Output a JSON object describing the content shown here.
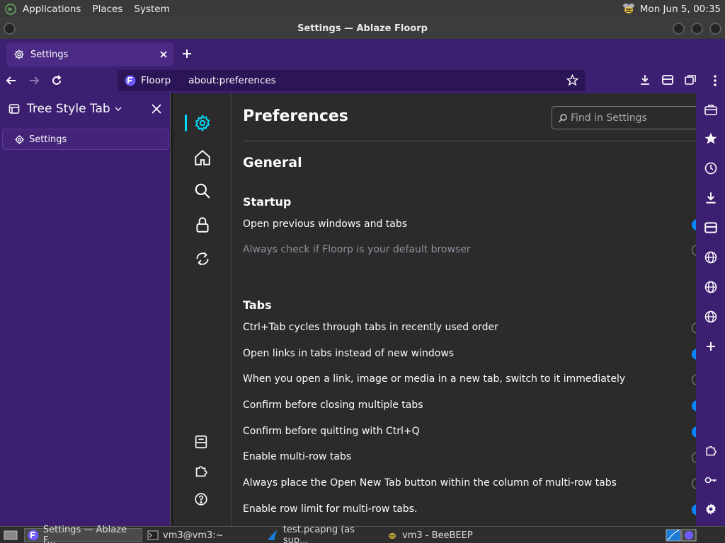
{
  "top_panel": {
    "menus": [
      "Applications",
      "Places",
      "System"
    ],
    "clock": "Mon Jun  5, 00:35"
  },
  "window": {
    "title": "Settings — Ablaze Floorp"
  },
  "tabs": {
    "active_tab_label": "Settings"
  },
  "urlbar": {
    "identity_label": "Floorp",
    "url": "about:preferences"
  },
  "sidebar": {
    "title": "Tree Style Tab",
    "tab_label": "Settings"
  },
  "prefs": {
    "title": "Preferences",
    "search_placeholder": "Find in Settings",
    "general_heading": "General",
    "startup_heading": "Startup",
    "startup_options": [
      {
        "label": "Open previous windows and tabs",
        "state": "on",
        "disabled": false
      },
      {
        "label": "Always check if Floorp is your default browser",
        "state": "off",
        "disabled": true
      }
    ],
    "tabs_heading": "Tabs",
    "tabs_options": [
      {
        "label": "Ctrl+Tab cycles through tabs in recently used order",
        "state": "off"
      },
      {
        "label": "Open links in tabs instead of new windows",
        "state": "on"
      },
      {
        "label": "When you open a link, image or media in a new tab, switch to it immediately",
        "state": "off"
      },
      {
        "label": "Confirm before closing multiple tabs",
        "state": "on"
      },
      {
        "label": "Confirm before quitting with Ctrl+Q",
        "state": "on"
      },
      {
        "label": "Enable multi-row tabs",
        "state": "off"
      },
      {
        "label": "Always place the Open New Tab button within the column of multi-row tabs",
        "state": "off"
      },
      {
        "label": "Enable row limit for multi-row tabs.",
        "state": "on"
      }
    ]
  },
  "taskbar": {
    "tasks": [
      "Settings — Ablaze F...",
      "vm3@vm3:~",
      "test.pcapng (as sup...",
      "vm3 - BeeBEEP"
    ]
  },
  "colors": {
    "accent": "#0a84ff",
    "chrome_purple": "#3c1f70",
    "content_bg": "#2b2b2b"
  }
}
